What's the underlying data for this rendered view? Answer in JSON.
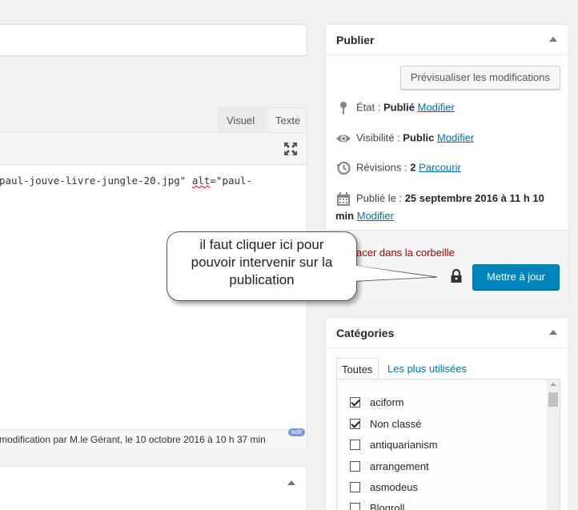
{
  "editor": {
    "tabs": [
      "Visuel",
      "Texte"
    ],
    "code_part1": "paul-jouve-livre-jungle-20.jpg\" ",
    "code_alt": "alt",
    "code_part2": "=\"paul-",
    "status": " modification par M.le Gérant, le 10 octobre 2016 à 10 h 37 min",
    "edit_badge": "edit"
  },
  "publish": {
    "title": "Publier",
    "preview_button": "Prévisualiser les modifications",
    "etat_label": "État : ",
    "etat_value": "Publié",
    "etat_link": "Modifier",
    "visibility_label": "Visibilité : ",
    "visibility_value": "Public",
    "visibility_link": "Modifier",
    "revisions_label": "Révisions : ",
    "revisions_value": "2",
    "revisions_link": "Parcourir",
    "date_label": "Publié le : ",
    "date_value": "25 septembre 2016 à 11 h 10 min",
    "date_link": "Modifier",
    "trash_link": "acer dans la corbeille",
    "update_button": "Mettre à jour"
  },
  "categories": {
    "title": "Catégories",
    "tab_all": "Toutes",
    "tab_popular": "Les plus utilisées",
    "items": [
      {
        "label": "aciform",
        "checked": true
      },
      {
        "label": "Non classé",
        "checked": true
      },
      {
        "label": "antiquarianism",
        "checked": false
      },
      {
        "label": "arrangement",
        "checked": false
      },
      {
        "label": "asmodeus",
        "checked": false
      },
      {
        "label": "Blogroll",
        "checked": false
      }
    ]
  },
  "callout": {
    "text_line1": "il faut cliquer ici pour",
    "text_line2": "pouvoir intervenir sur la",
    "text_line3": "publication"
  },
  "icons": [
    "fullscreen-icon",
    "pin-icon",
    "eye-icon",
    "history-icon",
    "calendar-icon",
    "lock-icon"
  ]
}
